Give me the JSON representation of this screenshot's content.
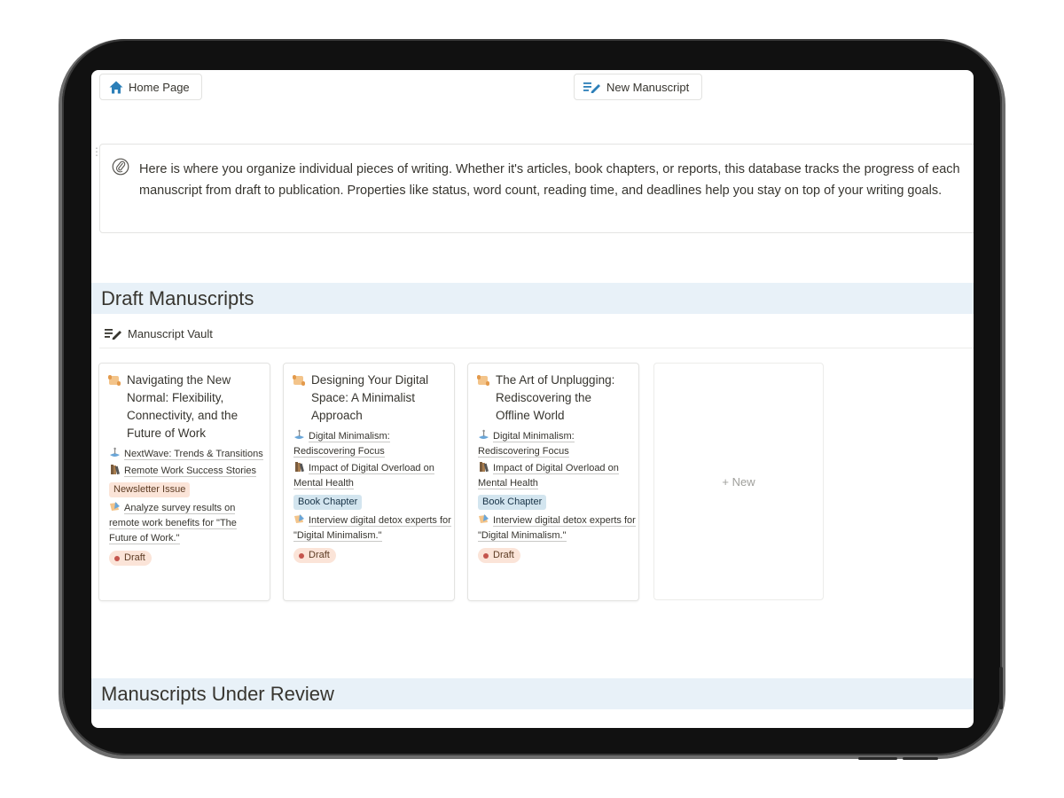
{
  "toolbar": {
    "home_label": "Home Page",
    "new_manuscript_label": "New Manuscript"
  },
  "callout": {
    "icon": "paperclip-icon",
    "text": "Here is where you organize individual pieces of writing. Whether it's articles, book chapters, or reports, this database tracks the progress of each manuscript from draft to publication. Properties like status, word count, reading time, and deadlines help you stay on top of your writing goals."
  },
  "sections": {
    "draft": {
      "title": "Draft Manuscripts",
      "view_label": "Manuscript Vault"
    },
    "review": {
      "title": "Manuscripts Under Review"
    }
  },
  "cards": [
    {
      "title": "Navigating the New Normal: Flexibility, Connectivity, and the Future of Work",
      "publication": "NextWave: Trends & Transitions",
      "series": "Remote Work Success Stories",
      "type": "Newsletter Issue",
      "task": "Analyze survey results on remote work benefits for \"The Future of Work.\"",
      "status": "Draft"
    },
    {
      "title": "Designing Your Digital Space: A Minimalist Approach",
      "publication": "Digital Minimalism: Rediscovering Focus",
      "series": "Impact of Digital Overload on Mental Health",
      "type": "Book Chapter",
      "task": "Interview digital detox experts for \"Digital Minimalism.\"",
      "status": "Draft"
    },
    {
      "title": "The Art of Unplugging: Rediscovering the Offline World",
      "publication": "Digital Minimalism: Rediscovering Focus",
      "series": "Impact of Digital Overload on Mental Health",
      "type": "Book Chapter",
      "task": "Interview digital detox experts for \"Digital Minimalism.\"",
      "status": "Draft"
    }
  ],
  "new_card_label": "+ New",
  "colors": {
    "section_bg": "#e8f1f8",
    "newsletter_tag": "#fbe4d8",
    "book_tag": "#d3e5ef",
    "draft_pill": "#fbe4d8",
    "draft_dot": "#c4554d",
    "home_icon": "#2c7fb8"
  }
}
